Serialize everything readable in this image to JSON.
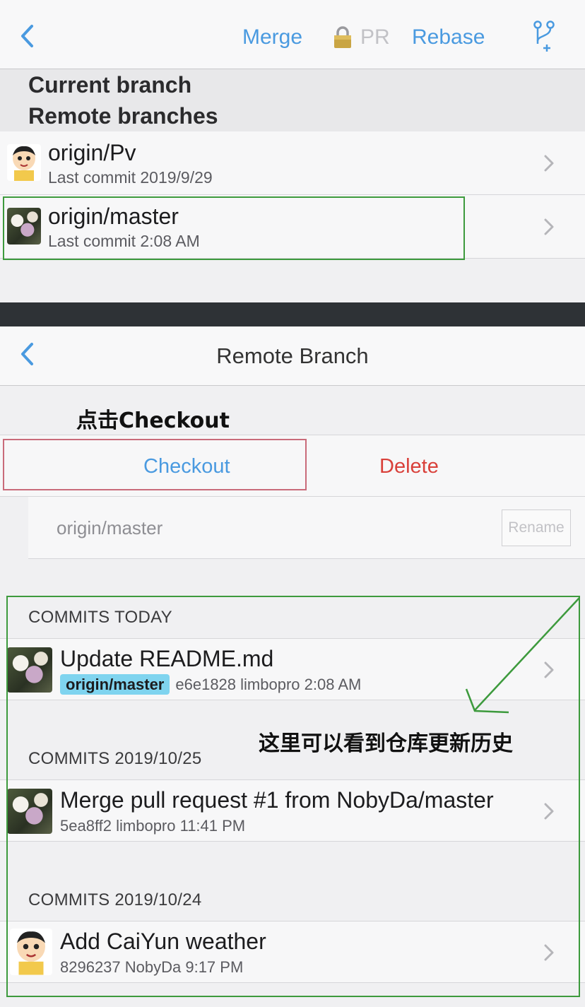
{
  "top_nav": {
    "merge": "Merge",
    "pr": "PR",
    "rebase": "Rebase"
  },
  "branches_header": {
    "current": "Current branch",
    "remote": "Remote branches"
  },
  "branches": [
    {
      "name": "origin/Pv",
      "last_commit": "Last commit 2019/9/29"
    },
    {
      "name": "origin/master",
      "last_commit": "Last commit 2:08 AM"
    }
  ],
  "remote_nav": {
    "title": "Remote Branch"
  },
  "annotations": {
    "checkout_hint": "点击Checkout",
    "history_hint": "这里可以看到仓库更新历史"
  },
  "actions": {
    "checkout": "Checkout",
    "delete": "Delete"
  },
  "branch_name": {
    "value": "origin/master",
    "rename": "Rename"
  },
  "sections": [
    {
      "header": "COMMITS TODAY",
      "commits": [
        {
          "title": "Update README.md",
          "tag": "origin/master",
          "meta": "e6e1828 limbopro 2:08 AM"
        }
      ]
    },
    {
      "header": "COMMITS 2019/10/25",
      "commits": [
        {
          "title": "Merge pull request #1 from NobyDa/master",
          "meta": "5ea8ff2 limbopro 11:41 PM"
        }
      ]
    },
    {
      "header": "COMMITS 2019/10/24",
      "commits": [
        {
          "title": "Add CaiYun weather",
          "meta": "8296237 NobyDa 9:17 PM"
        }
      ]
    }
  ],
  "colors": {
    "link": "#4a9ae0",
    "danger": "#d9403a",
    "tag": "#7fd4ef",
    "annotation_green": "#3d9a3d",
    "annotation_red": "#c96b7a"
  },
  "icons": [
    "back-chevron-icon",
    "lock-icon",
    "branch-add-icon",
    "disclosure-chevron-icon"
  ]
}
